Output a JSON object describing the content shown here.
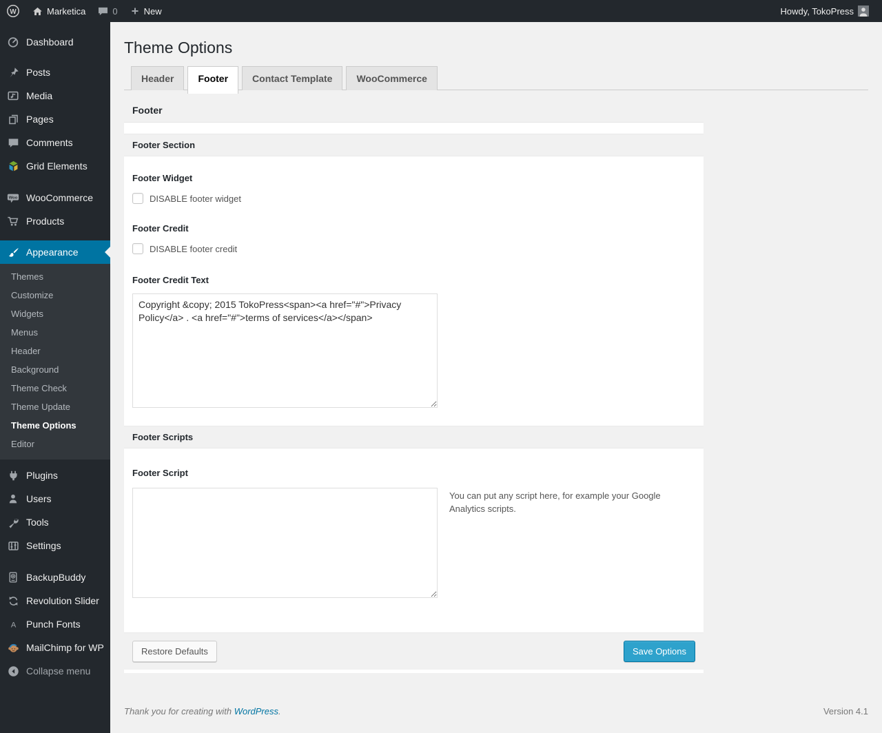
{
  "admin_bar": {
    "site_name": "Marketica",
    "comment_count": "0",
    "new_label": "New",
    "howdy": "Howdy, TokoPress"
  },
  "sidebar": {
    "dashboard": "Dashboard",
    "posts": "Posts",
    "media": "Media",
    "pages": "Pages",
    "comments": "Comments",
    "grid_elements": "Grid Elements",
    "woocommerce": "WooCommerce",
    "products": "Products",
    "appearance": "Appearance",
    "appearance_submenu": [
      "Themes",
      "Customize",
      "Widgets",
      "Menus",
      "Header",
      "Background",
      "Theme Check",
      "Theme Update",
      "Theme Options",
      "Editor"
    ],
    "plugins": "Plugins",
    "users": "Users",
    "tools": "Tools",
    "settings": "Settings",
    "backupbuddy": "BackupBuddy",
    "revolution_slider": "Revolution Slider",
    "punch_fonts": "Punch Fonts",
    "mailchimp": "MailChimp for WP",
    "collapse": "Collapse menu"
  },
  "icons": {
    "wp_logo_glyph": "W",
    "woo_badge": "Woo",
    "punch_fonts_glyph": "A"
  },
  "page": {
    "title": "Theme Options",
    "tabs": [
      {
        "label": "Header"
      },
      {
        "label": "Footer"
      },
      {
        "label": "Contact Template"
      },
      {
        "label": "WooCommerce"
      }
    ]
  },
  "panel": {
    "header": "Footer",
    "section1": {
      "title": "Footer Section",
      "footer_widget_label": "Footer Widget",
      "footer_widget_checkbox": "DISABLE footer widget",
      "footer_credit_label": "Footer Credit",
      "footer_credit_checkbox": "DISABLE footer credit",
      "footer_credit_text_label": "Footer Credit Text",
      "footer_credit_text_value": "Copyright &copy; 2015 TokoPress<span><a href=\"#\">Privacy Policy</a> . <a href=\"#\">terms of services</a></span>"
    },
    "section2": {
      "title": "Footer Scripts",
      "footer_script_label": "Footer Script",
      "footer_script_value": "",
      "footer_script_help": "You can put any script here, for example your Google Analytics scripts."
    },
    "restore_button": "Restore Defaults",
    "save_button": "Save Options"
  },
  "page_footer": {
    "thanks": "Thank you for creating with ",
    "wordpress_link": "WordPress",
    "period": ".",
    "version": "Version 4.1"
  },
  "colors": {
    "admin_bar_bg": "#23282d",
    "menu_active_bg": "#0074a2",
    "accent_blue": "#2ea2cc",
    "accent_blue_border": "#0074a2",
    "page_bg": "#f1f1f1"
  }
}
